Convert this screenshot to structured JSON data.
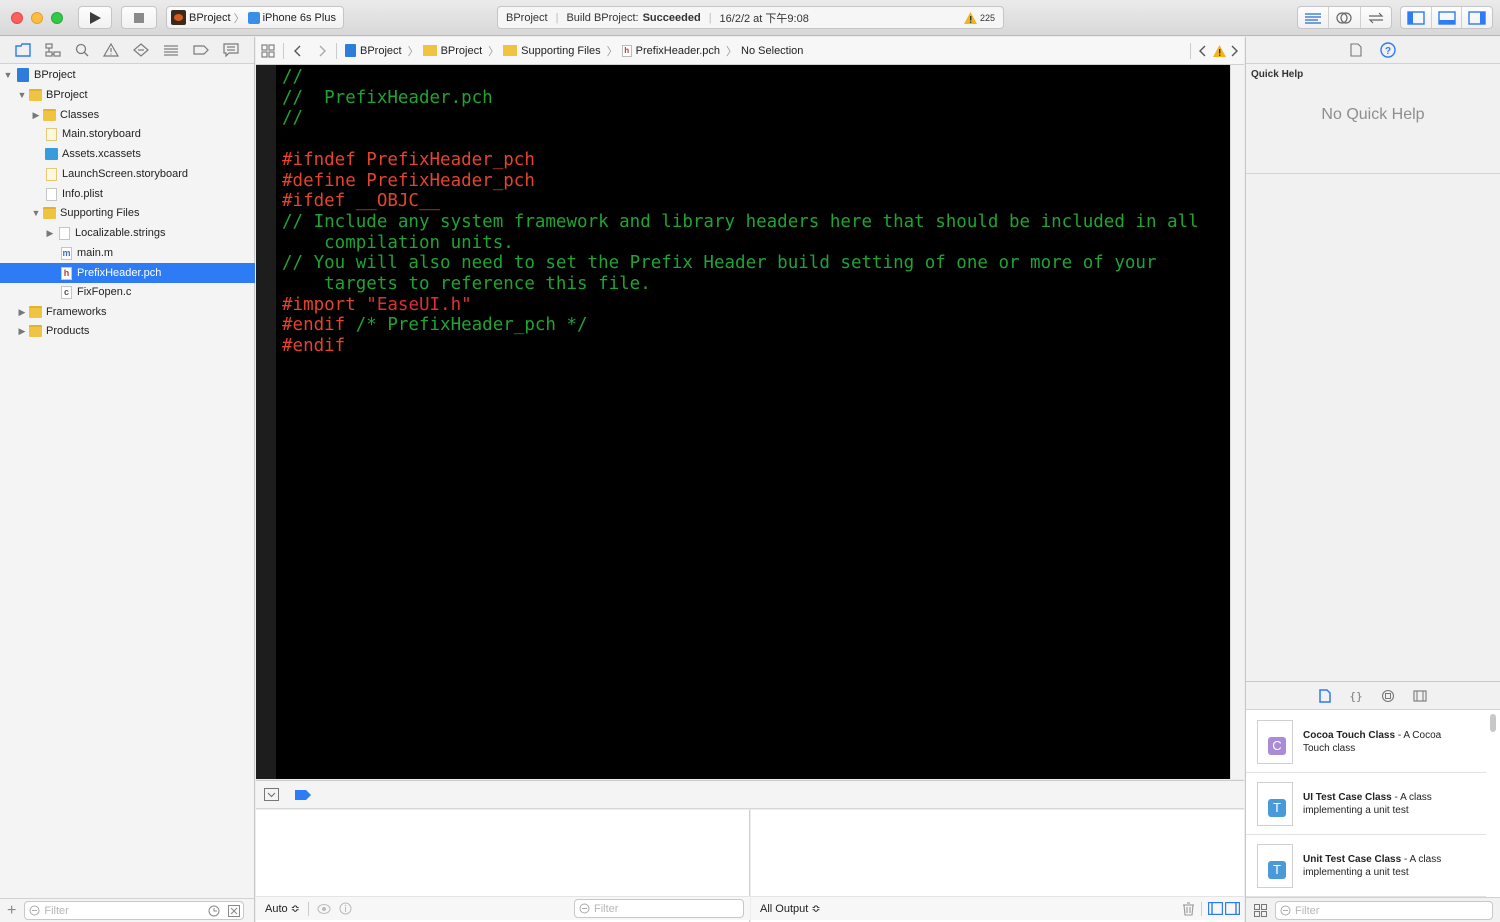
{
  "toolbar": {
    "scheme": {
      "project": "BProject",
      "device": "iPhone 6s Plus"
    },
    "activity": {
      "project": "BProject",
      "status_prefix": "Build BProject:",
      "status": "Succeeded",
      "time": "16/2/2 at 下午9:08",
      "warning_count": "225"
    },
    "icons": [
      "run-icon",
      "stop-icon",
      "standard-editor-icon",
      "assistant-editor-icon",
      "version-editor-icon",
      "navigator-toggle-icon",
      "debug-toggle-icon",
      "utilities-toggle-icon"
    ]
  },
  "navigator": {
    "tabs": [
      "project-navigator-icon",
      "symbol-navigator-icon",
      "find-navigator-icon",
      "issue-navigator-icon",
      "test-navigator-icon",
      "debug-navigator-icon",
      "breakpoint-navigator-icon",
      "report-navigator-icon"
    ],
    "tree": [
      {
        "label": "BProject"
      },
      {
        "label": "BProject"
      },
      {
        "label": "Classes"
      },
      {
        "label": "Main.storyboard"
      },
      {
        "label": "Assets.xcassets"
      },
      {
        "label": "LaunchScreen.storyboard"
      },
      {
        "label": "Info.plist"
      },
      {
        "label": "Supporting Files"
      },
      {
        "label": "Localizable.strings"
      },
      {
        "label": "main.m",
        "badge": "m"
      },
      {
        "label": "PrefixHeader.pch",
        "badge": "h"
      },
      {
        "label": "FixFopen.c",
        "badge": "c"
      },
      {
        "label": "Frameworks"
      },
      {
        "label": "Products"
      }
    ],
    "filter_placeholder": "Filter"
  },
  "jumpbar": {
    "crumbs": [
      "BProject",
      "BProject",
      "Supporting Files",
      "PrefixHeader.pch",
      "No Selection"
    ],
    "file_badge": "h"
  },
  "editor": {
    "lines": [
      {
        "text": "//",
        "kind": "comment"
      },
      {
        "text": "//  PrefixHeader.pch",
        "kind": "comment"
      },
      {
        "text": "//",
        "kind": "comment"
      },
      {
        "text": "",
        "kind": "blank"
      },
      {
        "text": "#ifndef PrefixHeader_pch",
        "kind": "pre"
      },
      {
        "text": "#define PrefixHeader_pch",
        "kind": "pre"
      },
      {
        "text": "#ifdef __OBJC__",
        "kind": "pre"
      },
      {
        "text": "// Include any system framework and library headers here that should be included in all",
        "kind": "comment"
      },
      {
        "text": "    compilation units.",
        "kind": "comment"
      },
      {
        "text": "// You will also need to set the Prefix Header build setting of one or more of your",
        "kind": "comment"
      },
      {
        "text": "    targets to reference this file.",
        "kind": "comment"
      },
      {
        "text": "#import ",
        "kind": "pre",
        "string": "\"EaseUI.h\""
      },
      {
        "text": "#endif",
        "kind": "pre",
        "comment": " /* PrefixHeader_pch */"
      },
      {
        "text": "#endif",
        "kind": "pre"
      }
    ],
    "colors": {
      "background": "#000000",
      "comment": "#1fa434",
      "preprocessor": "#e5432c",
      "string": "#e03030"
    }
  },
  "debug": {
    "auto_label": "Auto ≎",
    "vars_filter_placeholder": "Filter",
    "output_label": "All Output ≎"
  },
  "inspector": {
    "quick_help_title": "Quick Help",
    "no_quick_help": "No Quick Help",
    "library_templates": [
      {
        "name": "Cocoa Touch Class",
        "desc_1": " - A Cocoa",
        "desc_2": "Touch class",
        "badge": "C"
      },
      {
        "name": "UI Test Case Class",
        "desc_1": " - A class",
        "desc_2": "implementing a unit test",
        "badge": "T"
      },
      {
        "name": "Unit Test Case Class",
        "desc_1": " - A class",
        "desc_2": "implementing a unit test",
        "badge": "T"
      }
    ],
    "filter_placeholder": "Filter"
  }
}
